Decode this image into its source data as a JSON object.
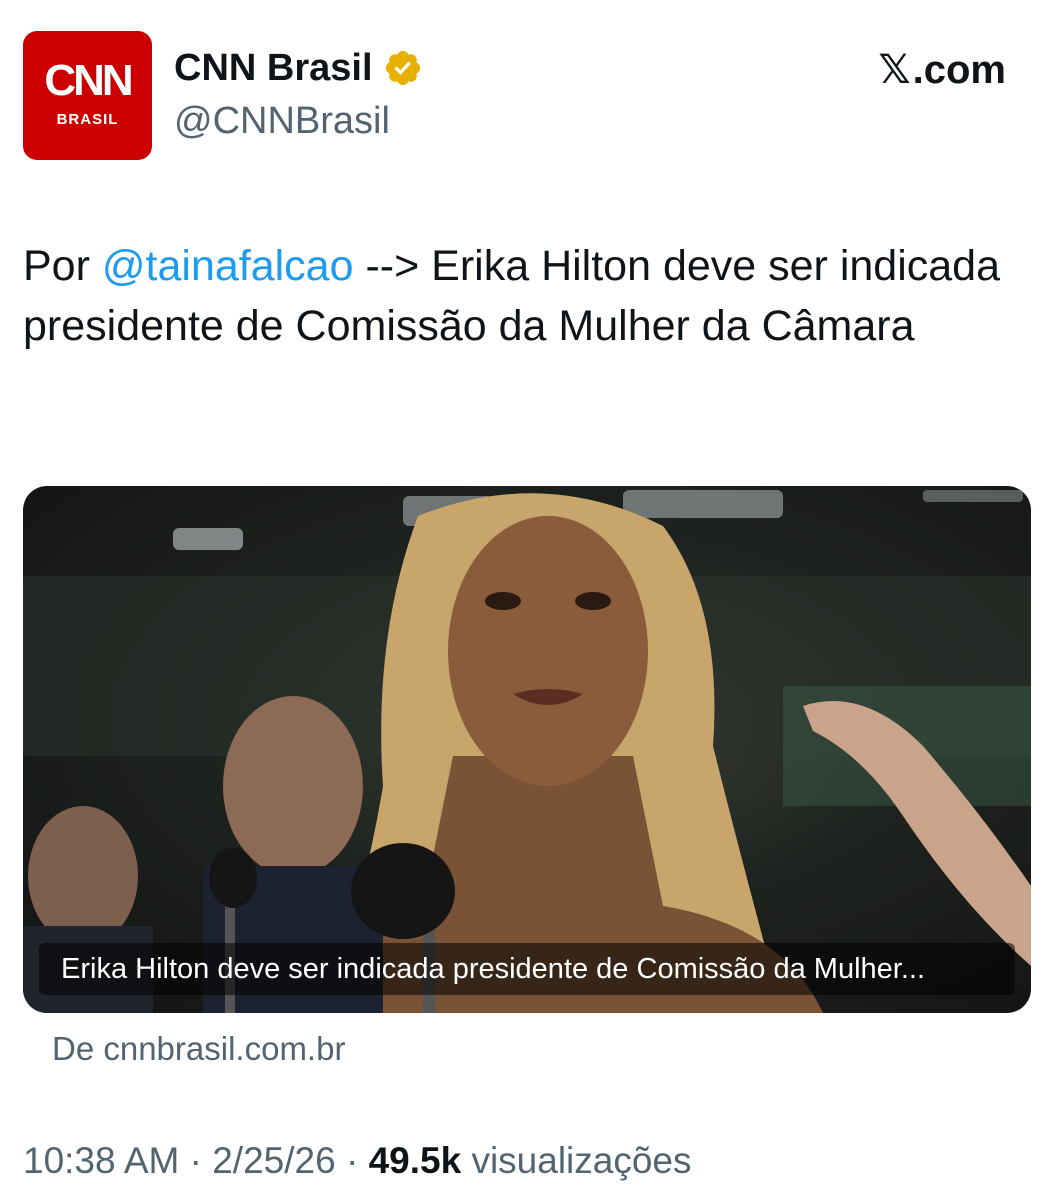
{
  "author": {
    "display_name": "CNN Brasil",
    "handle": "@CNNBrasil",
    "verified_icon": "gold-verified-badge-icon",
    "avatar": {
      "logo_text": "CNN",
      "logo_subtext": "BRASIL",
      "color": "#cc0000"
    }
  },
  "platform": {
    "x_glyph": "𝕏",
    "domain": ".com"
  },
  "tweet": {
    "prefix": "Por ",
    "mention": "@tainafalcao",
    "text": " --> Erika Hilton deve ser indicada presidente de Comissão da Mulher da Câmara"
  },
  "link_card": {
    "image_icon": "news-photo",
    "caption": "Erika Hilton deve ser indicada presidente de Comissão da Mulher...",
    "source": "De cnnbrasil.com.br"
  },
  "meta": {
    "time": "10:38 AM",
    "sep1": " · ",
    "date": "2/25/26",
    "sep2": " · ",
    "views_count": "49.5k",
    "views_label": " visualizações"
  },
  "colors": {
    "accent": "#1d9bf0",
    "secondary_text": "#536471",
    "primary_text": "#0f1419",
    "verified": "#f4b400"
  }
}
